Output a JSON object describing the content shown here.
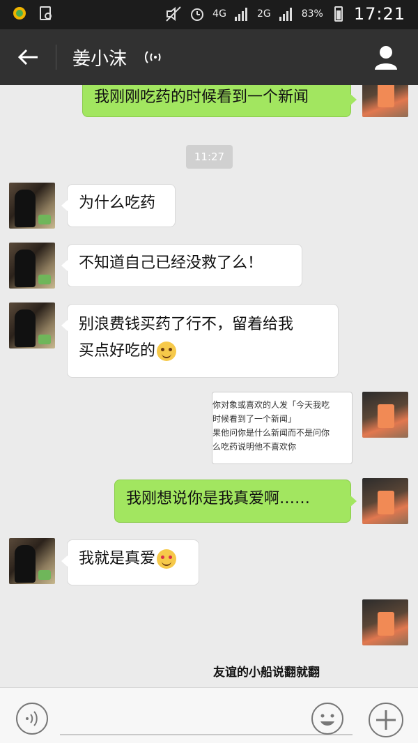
{
  "status_bar": {
    "network_left": "4G",
    "network_right": "2G",
    "battery": "83%",
    "time": "17:21"
  },
  "header": {
    "contact_name": "姜小沫",
    "icons": [
      "back-arrow-icon",
      "voice-mode-icon",
      "profile-icon"
    ]
  },
  "messages": [
    {
      "side": "right",
      "text": "我刚刚吃药的时候看到一个新闻"
    },
    {
      "side": "left",
      "text": "为什么吃药"
    },
    {
      "side": "left",
      "text": "不知道自己已经没救了么！"
    },
    {
      "side": "left",
      "text_line1": "别浪费钱买药了行不，留着给我",
      "text_line2": "买点好吃的",
      "emoji": "smile-emoji"
    },
    {
      "side": "right",
      "text": "我刚想说你是我真爱啊……"
    },
    {
      "side": "left",
      "text": "我就是真爱",
      "emoji": "heart-eyes-emoji"
    }
  ],
  "timestamp": "11:27",
  "shared_image": {
    "lines": [
      "给你对象或喜欢的人发「今天我吃",
      "的时候看到了一个新闻」",
      "如果他问你是什么新闻而不是问你",
      "什么吃药说明他不喜欢你"
    ]
  },
  "caption": "友谊的小船说翻就翻",
  "input_bar": {
    "icons": [
      "voice-input-icon",
      "emoji-icon",
      "plus-icon"
    ]
  },
  "colors": {
    "status_bar_bg": "#1c1c1c",
    "title_bar_bg": "#313131",
    "chat_bg": "#ebebeb",
    "outgoing_bubble": "#a2e660",
    "incoming_bubble": "#ffffff"
  }
}
